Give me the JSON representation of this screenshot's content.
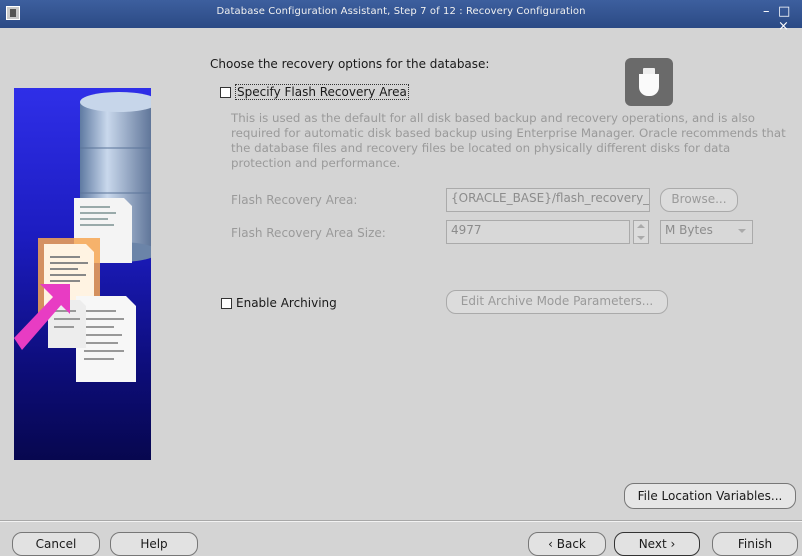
{
  "window": {
    "title": "Database Configuration Assistant, Step 7 of 12 : Recovery Configuration",
    "minimize_glyph": "–",
    "close_glyph": "□ ×"
  },
  "main": {
    "heading": "Choose the recovery options for the database:",
    "flash_checkbox_label": "Specify Flash Recovery Area",
    "flash_checkbox_checked": false,
    "description": "This is used as the default for all disk based backup and recovery operations, and is also required for automatic disk based backup using Enterprise Manager. Oracle recommends that the database files and recovery files be located on physically different disks for data protection and performance.",
    "flash_area_label": "Flash Recovery Area:",
    "flash_area_value": "{ORACLE_BASE}/flash_recovery_",
    "browse_label": "Browse...",
    "flash_size_label": "Flash Recovery Area Size:",
    "flash_size_value": "4977",
    "unit_value": "M Bytes",
    "archiving_label": "Enable Archiving",
    "archiving_checked": false,
    "edit_archive_label": "Edit Archive Mode Parameters...",
    "file_location_label": "File Location Variables..."
  },
  "footer": {
    "cancel": "Cancel",
    "help": "Help",
    "back": "Back",
    "next": "Next",
    "finish": "Finish"
  },
  "icons": {
    "usb": "usb-drive-icon",
    "app": "oracle-app-icon"
  },
  "colors": {
    "title_bar": "#2b4a85",
    "art_panel": "#1c1cc0",
    "disabled_text": "#9a9a9a",
    "arrow": "#e83cc3"
  }
}
